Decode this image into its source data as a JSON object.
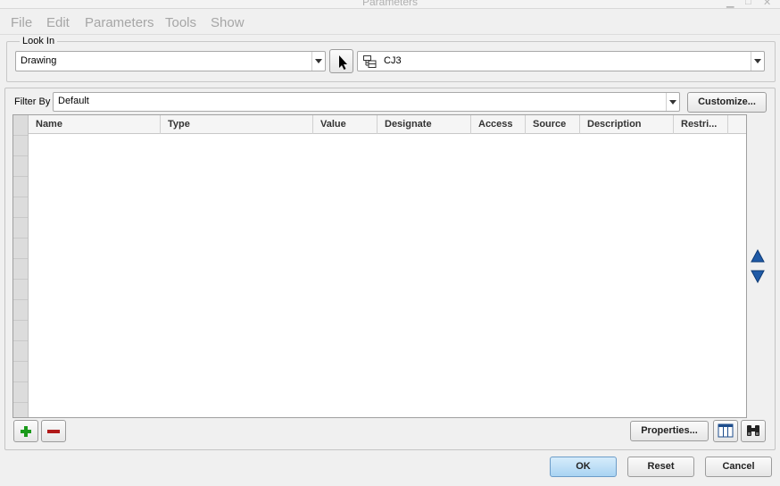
{
  "window": {
    "title": "Parameters"
  },
  "menu": {
    "items": [
      "File",
      "Edit",
      "Parameters",
      "Tools",
      "Show"
    ]
  },
  "look_in": {
    "legend": "Look In",
    "type_value": "Drawing",
    "object_value": "CJ3"
  },
  "filter": {
    "label": "Filter By",
    "value": "Default",
    "customize_label": "Customize..."
  },
  "table": {
    "columns": [
      "Name",
      "Type",
      "Value",
      "Designate",
      "Access",
      "Source",
      "Description",
      "Restri..."
    ],
    "rows": []
  },
  "actions": {
    "properties_label": "Properties..."
  },
  "footer": {
    "ok_label": "OK",
    "reset_label": "Reset",
    "cancel_label": "Cancel"
  },
  "colors": {
    "ok_button": "#bfe0f6",
    "move_arrows": "#1f5aa6",
    "add_icon": "#1a9a1a",
    "remove_icon": "#b01818"
  }
}
